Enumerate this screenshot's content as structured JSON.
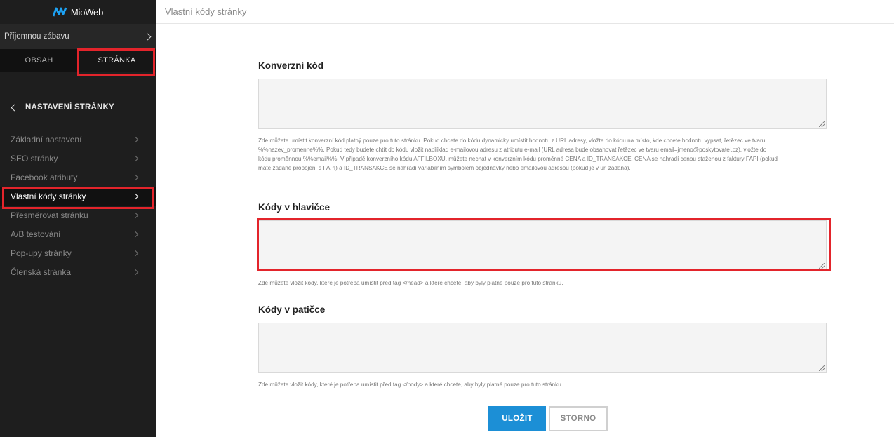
{
  "app": {
    "brand": "MioWeb"
  },
  "sidebar": {
    "page_selector": "Příjemnou zábavu",
    "tabs": [
      {
        "label": "OBSAH",
        "active": false
      },
      {
        "label": "STRÁNKA",
        "active": true
      }
    ],
    "section_title": "NASTAVENÍ STRÁNKY",
    "items": [
      {
        "label": "Základní nastavení"
      },
      {
        "label": "SEO stránky"
      },
      {
        "label": "Facebook atributy"
      },
      {
        "label": "Vlastní kódy stránky",
        "active": true
      },
      {
        "label": "Přesměrovat stránku"
      },
      {
        "label": "A/B testování"
      },
      {
        "label": "Pop-upy stránky"
      },
      {
        "label": "Členská stránka"
      }
    ]
  },
  "header": {
    "title": "Vlastní kódy stránky"
  },
  "form": {
    "conversion": {
      "label": "Konverzní kód",
      "value": "",
      "help": "Zde můžete umístit konverzní kód platný pouze pro tuto stránku. Pokud chcete do kódu dynamicky umístit hodnotu z URL adresy, vložte do kódu na místo, kde chcete hodnotu vypsat, řetězec ve tvaru: %%nazev_promenne%%. Pokud tedy budete chtít do kódu vložit například e-mailovou adresu z atributu e-mail (URL adresa bude obsahovat řetězec ve tvaru email=jmeno@poskytovatel.cz), vložte do kódu proměnnou %%email%%. V případě konverzního kódu AFFILBOXU, můžete nechat v konverzním kódu proměnné CENA a ID_TRANSAKCE. CENA se nahradí cenou staženou z faktury FAPI (pokud máte zadané propojení s FAPI) a ID_TRANSAKCE se nahradí variabilním symbolem objednávky nebo emailovou adresou (pokud je v url zadaná)."
    },
    "head": {
      "label": "Kódy v hlavičce",
      "value": "",
      "help": "Zde můžete vložit kódy, které je potřeba umístit před tag </head> a které chcete, aby byly platné pouze pro tuto stránku."
    },
    "footer": {
      "label": "Kódy v patičce",
      "value": "",
      "help": "Zde můžete vložit kódy, které je potřeba umístit před tag </body> a které chcete, aby byly platné pouze pro tuto stránku."
    },
    "save_label": "ULOŽIT",
    "cancel_label": "STORNO"
  },
  "colors": {
    "accent": "#1c8fd6",
    "highlight": "#e3242b",
    "sidebar_bg": "#1e1e1e"
  }
}
